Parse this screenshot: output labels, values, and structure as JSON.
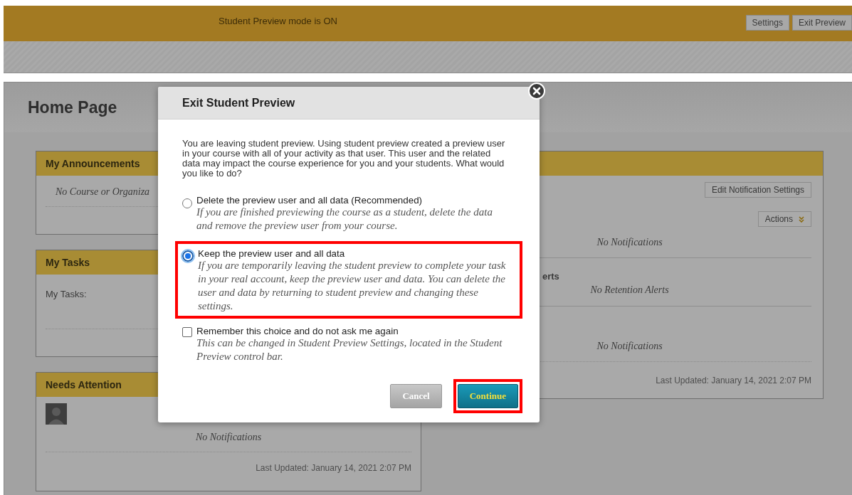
{
  "preview_bar": {
    "message": "Student Preview mode is ON",
    "buttons": [
      "Settings",
      "Exit Preview"
    ]
  },
  "page": {
    "title": "Home Page"
  },
  "left_modules": [
    {
      "title": "My Announcements",
      "items": [
        {
          "kind": "empty",
          "text": "No Course or Organiza"
        }
      ]
    },
    {
      "title": "My Tasks",
      "items": [
        {
          "kind": "label",
          "text": "My Tasks:"
        }
      ]
    },
    {
      "title": "Needs Attention",
      "items": [
        {
          "kind": "avatar"
        },
        {
          "kind": "empty",
          "text": "No Notifications"
        },
        {
          "kind": "updated",
          "text": "Last Updated: January 14, 2021 2:07 PM"
        }
      ]
    }
  ],
  "right_module": {
    "buttons": [
      {
        "kind": "plain",
        "label": "Edit Notification Settings"
      },
      {
        "kind": "menu",
        "label": "Actions"
      }
    ],
    "sections": [
      {
        "empty": "No Notifications"
      },
      {
        "heading": "erts",
        "empty": "No Retention Alerts"
      },
      {
        "empty": "No Notifications"
      }
    ],
    "updated": "Last Updated: January 14, 2021 2:07 PM"
  },
  "dialog": {
    "title": "Exit Student Preview",
    "intro": "You are leaving student preview. Using student preview created a preview user in your course with all of your activity as that user. This user and the related data may impact the course experience for you and your students. What would you like to do?",
    "options": [
      {
        "label": "Delete the preview user and all data (Recommended)",
        "description": "If you are finished previewing the course as a student, delete the data and remove the preview user from your course.",
        "selected": false,
        "highlighted": false
      },
      {
        "label": "Keep the preview user and all data",
        "description": "If you are temporarily leaving the student preview to complete your task in your real account, keep the preview user and data. You can delete the user and data by returning to student preview and changing these settings.",
        "selected": true,
        "highlighted": true
      }
    ],
    "remember": {
      "label": "Remember this choice and do not ask me again",
      "description": "This can be changed in Student Preview Settings, located in the Student Preview control bar.",
      "checked": false
    },
    "buttons": [
      {
        "kind": "cancel",
        "label": "Cancel",
        "highlighted": false
      },
      {
        "kind": "primary",
        "label": "Continue",
        "highlighted": true
      }
    ]
  }
}
